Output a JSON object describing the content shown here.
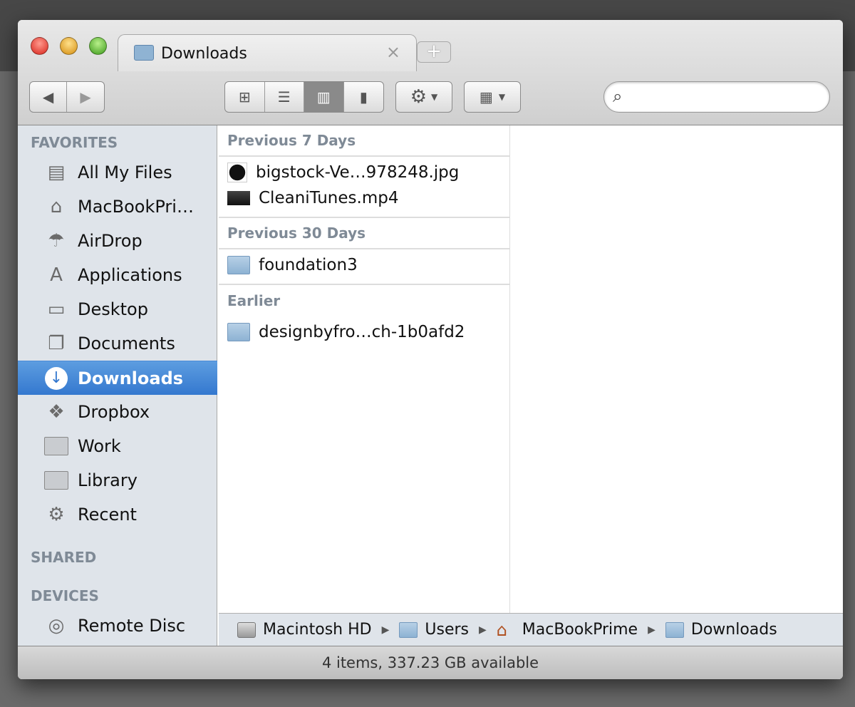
{
  "tab": {
    "title": "Downloads",
    "close": "×",
    "new_tab": "+"
  },
  "toolbar": {
    "back": "◀",
    "forward": "▶",
    "search_placeholder": ""
  },
  "sidebar": {
    "favorites_header": "FAVORITES",
    "items": [
      {
        "label": "All My Files",
        "icon": "all-files-icon"
      },
      {
        "label": "MacBookPrime",
        "icon": "home-icon"
      },
      {
        "label": "AirDrop",
        "icon": "airdrop-icon"
      },
      {
        "label": "Applications",
        "icon": "applications-icon"
      },
      {
        "label": "Desktop",
        "icon": "desktop-icon"
      },
      {
        "label": "Documents",
        "icon": "documents-icon"
      },
      {
        "label": "Downloads",
        "icon": "downloads-icon",
        "selected": true
      },
      {
        "label": "Dropbox",
        "icon": "dropbox-icon"
      },
      {
        "label": "Work",
        "icon": "folder-icon"
      },
      {
        "label": "Library",
        "icon": "folder-icon"
      },
      {
        "label": "Recent",
        "icon": "gear-icon"
      }
    ],
    "shared_header": "SHARED",
    "devices_header": "DEVICES",
    "devices": [
      {
        "label": "Remote Disc",
        "icon": "disc-icon"
      }
    ]
  },
  "groups": [
    {
      "header": "Previous 7 Days",
      "items": [
        "bigstock-Ve…978248.jpg",
        "CleaniTunes.mp4"
      ]
    },
    {
      "header": "Previous 30 Days",
      "items": [
        "foundation3"
      ]
    },
    {
      "header": "Earlier",
      "items": [
        "designbyfro…ch-1b0afd2"
      ]
    }
  ],
  "path": [
    "Macintosh HD",
    "Users",
    "MacBookPrime",
    "Downloads"
  ],
  "status": "4 items, 337.23 GB available",
  "colors": {
    "selection": "#3d82d6",
    "sidebar": "#dfe4ea"
  }
}
